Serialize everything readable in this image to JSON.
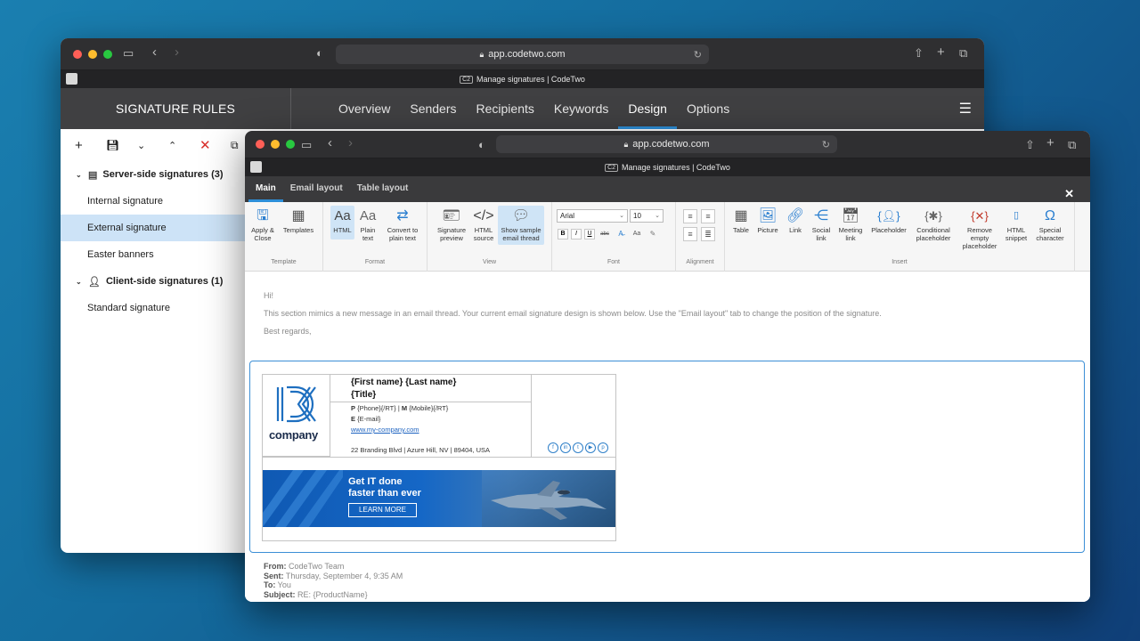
{
  "back_window": {
    "url": "app.codetwo.com",
    "tab_title": "Manage signatures | CodeTwo",
    "tab_badge": "C2",
    "app_title": "SIGNATURE RULES",
    "nav": [
      "Overview",
      "Senders",
      "Recipients",
      "Keywords",
      "Design",
      "Options"
    ],
    "nav_active": "Design",
    "toolbar_icons": [
      "plus-icon",
      "save-icon",
      "chevron-down-icon",
      "chevron-up-icon",
      "delete-icon",
      "copy-icon"
    ],
    "tree": {
      "server_group": "Server-side signatures (3)",
      "server_items": [
        "Internal signature",
        "External signature",
        "Easter banners"
      ],
      "selected": "External signature",
      "client_group": "Client-side signatures (1)",
      "client_items": [
        "Standard signature"
      ]
    }
  },
  "front_window": {
    "url": "app.codetwo.com",
    "tab_title": "Manage signatures | CodeTwo",
    "tab_badge": "C2",
    "ribbon_tabs": [
      "Main",
      "Email layout",
      "Table layout"
    ],
    "ribbon_active": "Main",
    "groups": {
      "template": {
        "label": "Template",
        "apply": "Apply & Close",
        "templates": "Templates"
      },
      "format": {
        "label": "Format",
        "html": "HTML",
        "plain": "Plain text",
        "convert": "Convert to plain text",
        "html_glyph": "Aa",
        "plain_glyph": "Aa"
      },
      "view": {
        "label": "View",
        "preview": "Signature preview",
        "source": "HTML source",
        "sample": "Show sample email thread"
      },
      "font": {
        "label": "Font",
        "family": "Arial",
        "size": "10",
        "bold": "B",
        "italic": "I",
        "underline": "U",
        "strike": "abc",
        "case": "Aa"
      },
      "alignment": {
        "label": "Alignment"
      },
      "insert": {
        "label": "Insert",
        "table": "Table",
        "picture": "Picture",
        "link": "Link",
        "social": "Social link",
        "meeting": "Meeting link",
        "placeholder": "Placeholder",
        "conditional": "Conditional placeholder",
        "remove": "Remove empty placeholder",
        "snippet": "HTML snippet",
        "special": "Special character"
      }
    },
    "email": {
      "greeting": "Hi!",
      "body": "This section mimics a new message in an email thread. Your current email signature design is shown below. Use the \"Email layout\" tab to change the position of the signature.",
      "closing": "Best regards,"
    },
    "signature": {
      "logo_text": "company",
      "name_line": "{First name} {Last name}",
      "title_line": "{Title}",
      "phone_label": "P",
      "phone_value": "{Phone}{/RT} | ",
      "mobile_label": "M",
      "mobile_value": "{Mobile}{/RT}",
      "email_label": "E",
      "email_value": "{E-mail}",
      "website": "www.my-company.com",
      "address": "22 Branding Blvd | Azure Hill, NV | 89404, USA",
      "social_icons": [
        "facebook-icon",
        "linkedin-icon",
        "twitter-icon",
        "youtube-icon",
        "pinterest-icon"
      ],
      "banner_line1": "Get IT done",
      "banner_line2": "faster than ever",
      "banner_cta": "LEARN MORE"
    },
    "thread_meta": {
      "from_label": "From:",
      "from_value": "CodeTwo Team",
      "sent_label": "Sent:",
      "sent_value": "Thursday, September 4, 9:35 AM",
      "to_label": "To:",
      "to_value": "You",
      "subject_label": "Subject:",
      "subject_value": "RE: {ProductName}"
    }
  },
  "colors": {
    "accent": "#2d8fd9",
    "selection": "#cde3f7",
    "delete": "#d9302c",
    "chrome": "#2f2f31"
  }
}
